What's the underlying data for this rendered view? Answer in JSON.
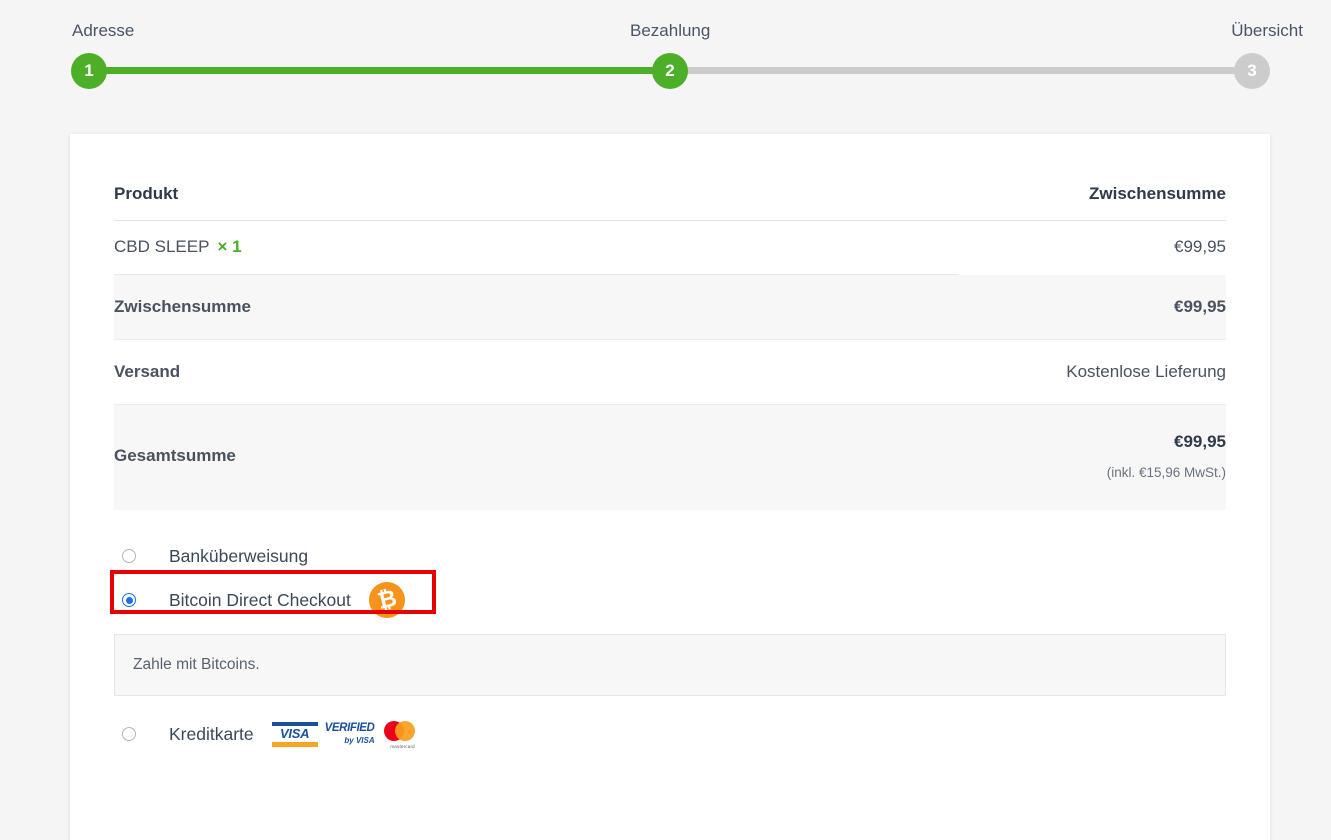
{
  "steps": [
    {
      "label": "Adresse",
      "number": "1",
      "state": "done"
    },
    {
      "label": "Bezahlung",
      "number": "2",
      "state": "current"
    },
    {
      "label": "Übersicht",
      "number": "3",
      "state": "todo"
    }
  ],
  "order": {
    "header": {
      "product": "Produkt",
      "subtotal": "Zwischensumme"
    },
    "items": [
      {
        "name": "CBD SLEEP",
        "qty": "× 1",
        "amount": "€99,95"
      }
    ],
    "summary": {
      "subtotal_label": "Zwischensumme",
      "subtotal_value": "€99,95",
      "shipping_label": "Versand",
      "shipping_value": "Kostenlose Lieferung",
      "total_label": "Gesamtsumme",
      "total_value": "€99,95",
      "total_tax_note": "(inkl. €15,96 MwSt.)"
    }
  },
  "payment": {
    "methods": [
      {
        "label": "Banküberweisung",
        "selected": false
      },
      {
        "label": "Bitcoin Direct Checkout",
        "selected": true
      },
      {
        "label": "Kreditkarte",
        "selected": false
      }
    ],
    "bitcoin_icon_glyph": "₿",
    "description": "Zahle mit Bitcoins.",
    "card_brands": [
      {
        "name": "visa",
        "text": "VISA"
      },
      {
        "name": "verified-by-visa",
        "line1": "VERIFIED",
        "line2": "by VISA"
      },
      {
        "name": "mastercard",
        "text": "mastercard"
      }
    ]
  },
  "colors": {
    "step_done": "#4caf27",
    "step_todo": "#cccccc",
    "accent_qty": "#4caf27",
    "radio_selected": "#1673e6",
    "bitcoin_orange": "#f7931a",
    "highlight": "#e60000"
  }
}
